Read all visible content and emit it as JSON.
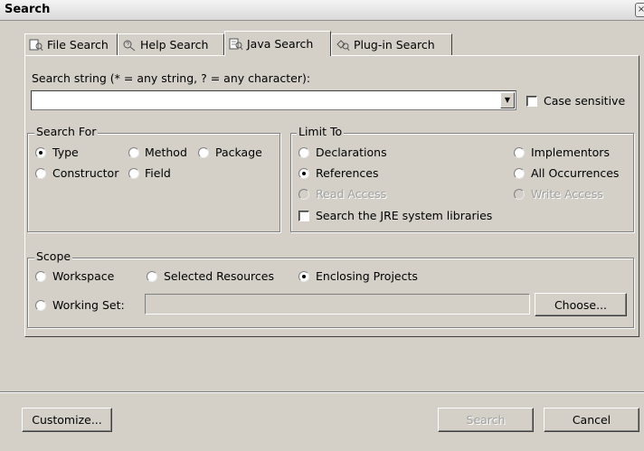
{
  "window": {
    "title": "Search"
  },
  "tabs": [
    {
      "label": "File Search",
      "icon": "file-search-icon"
    },
    {
      "label": "Help Search",
      "icon": "help-search-icon"
    },
    {
      "label": "Java Search",
      "icon": "java-search-icon",
      "active": true
    },
    {
      "label": "Plug-in Search",
      "icon": "plugin-search-icon"
    }
  ],
  "search": {
    "label": "Search string (* = any string, ? = any character):",
    "value": "",
    "case_sensitive_label": "Case sensitive",
    "case_sensitive": false
  },
  "search_for": {
    "legend": "Search For",
    "options": [
      "Type",
      "Method",
      "Package",
      "Constructor",
      "Field"
    ],
    "selected": "Type"
  },
  "limit_to": {
    "legend": "Limit To",
    "options": [
      "Declarations",
      "Implementors",
      "References",
      "All Occurrences",
      "Read Access",
      "Write Access"
    ],
    "disabled": [
      "Read Access",
      "Write Access"
    ],
    "selected": "References",
    "jre_label": "Search the JRE system libraries",
    "jre_checked": false
  },
  "scope": {
    "legend": "Scope",
    "workspace": "Workspace",
    "selected_resources": "Selected Resources",
    "enclosing_projects": "Enclosing Projects",
    "working_set": "Working Set:",
    "working_set_value": "",
    "choose_button": "Choose...",
    "selected": "Enclosing Projects"
  },
  "footer": {
    "customize_button": "Customize...",
    "search_button": "Search",
    "search_disabled": true,
    "cancel_button": "Cancel"
  }
}
